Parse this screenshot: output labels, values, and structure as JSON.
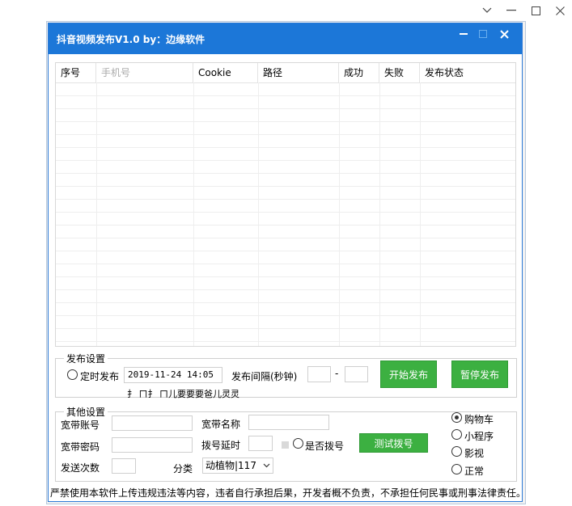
{
  "window": {
    "title": "抖音视频发布V1.0 by：边缘软件"
  },
  "grid": {
    "columns": [
      {
        "label": "序号",
        "muted": false
      },
      {
        "label": "手机号",
        "muted": true
      },
      {
        "label": "Cookie",
        "muted": false
      },
      {
        "label": "路径",
        "muted": false
      },
      {
        "label": "成功",
        "muted": false
      },
      {
        "label": "失败",
        "muted": false
      },
      {
        "label": "发布状态",
        "muted": false
      }
    ]
  },
  "publish_settings": {
    "legend": "发布设置",
    "scheduled_label": "定时发布",
    "scheduled_checked": false,
    "datetime": "2019-11-24 14:05",
    "interval_label": "发布间隔(秒钟)",
    "interval_from": "",
    "interval_sep": "-",
    "interval_to": "",
    "start_button": "开始发布",
    "pause_button": "暂停发布",
    "status_text": "扌 ㄇ扌 ㄇ儿要要要爸儿灵灵"
  },
  "other_settings": {
    "legend": "其他设置",
    "broadband_account_label": "宽带账号",
    "broadband_account_value": "",
    "broadband_name_label": "宽带名称",
    "broadband_name_value": "",
    "broadband_password_label": "宽带密码",
    "broadband_password_value": "",
    "dial_delay_label": "拨号延时",
    "dial_delay_value": "",
    "dial_label": "是否拨号",
    "dial_checked": false,
    "test_dial_button": "测试拨号",
    "send_count_label": "发送次数",
    "send_count_value": "",
    "category_label": "分类",
    "category_value": "动植物|117"
  },
  "mode_options": [
    {
      "label": "购物车",
      "checked": true
    },
    {
      "label": "小程序",
      "checked": false
    },
    {
      "label": "影视",
      "checked": false
    },
    {
      "label": "正常",
      "checked": false
    }
  ],
  "footer": {
    "text": "严禁使用本软件上传违规违法等内容，违者自行承担后果，开发者概不负责，不承担任何民事或刑事法律责任。"
  },
  "colors": {
    "titlebar": "#1c77d8",
    "button_green": "#3cb041"
  }
}
